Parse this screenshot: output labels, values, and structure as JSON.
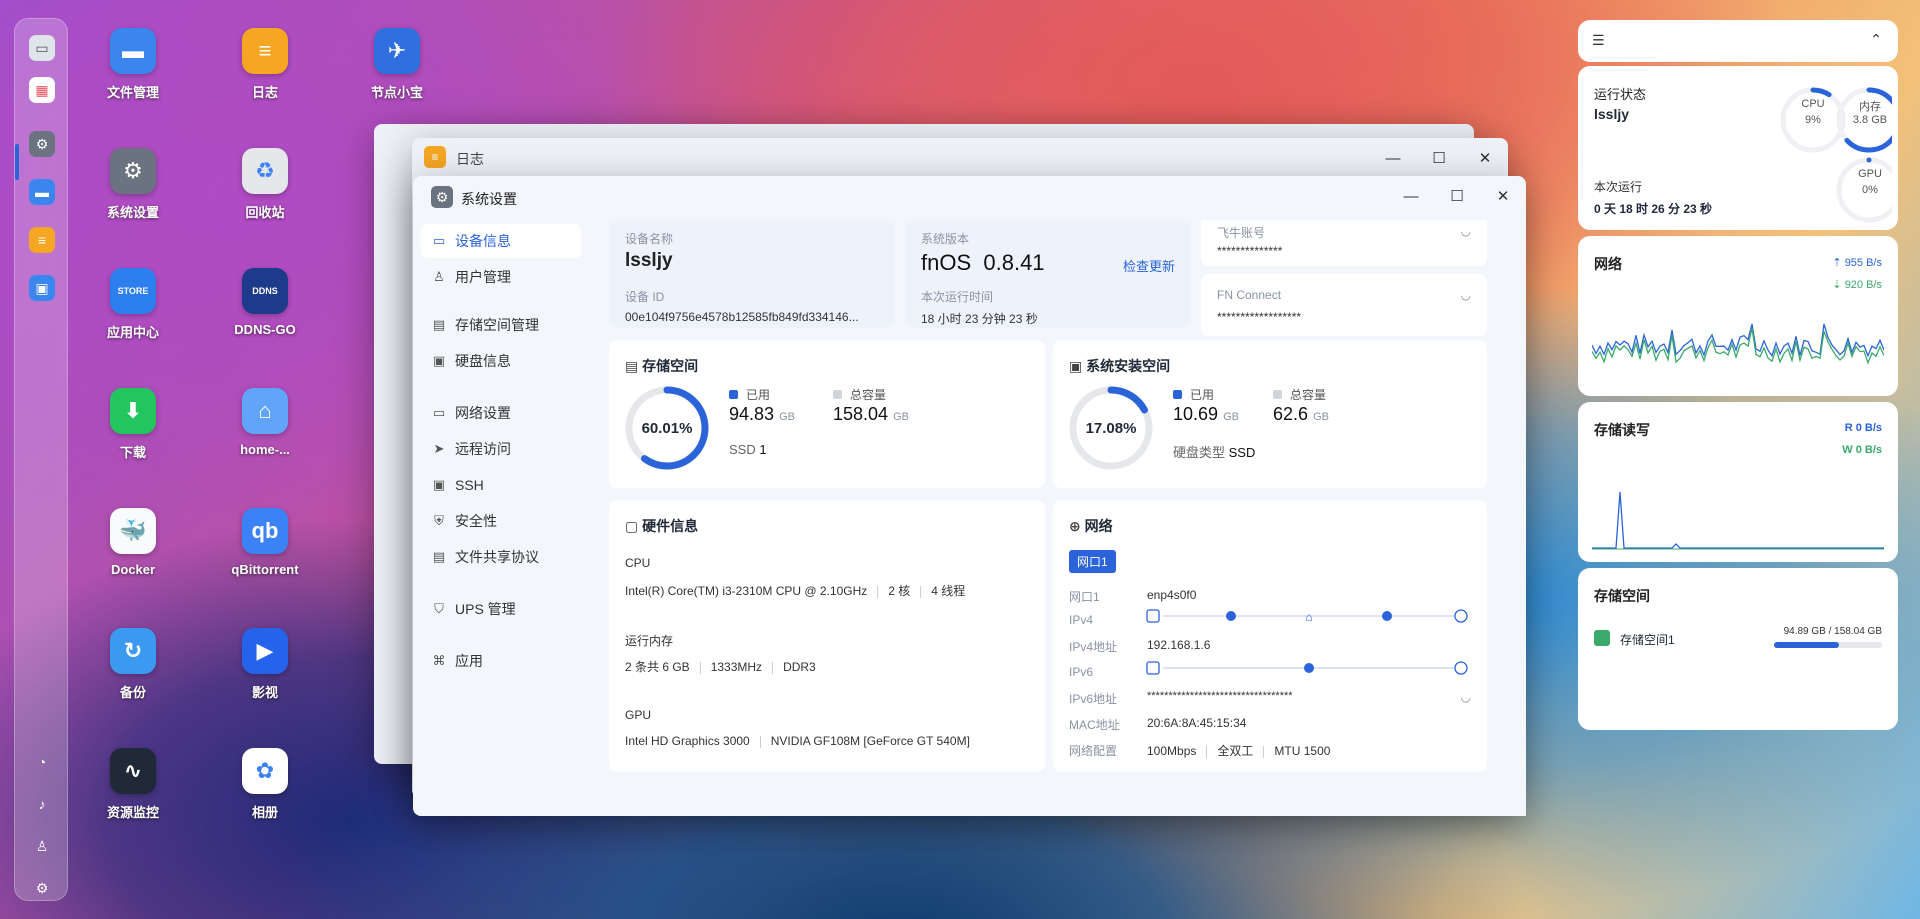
{
  "dock": {
    "icons": [
      "monitor-icon",
      "apps-grid-icon",
      "settings-icon",
      "folder-icon",
      "notes-icon",
      "disk-icon",
      "sync-icon",
      "bell-icon",
      "user-icon",
      "gear-icon"
    ]
  },
  "desktop": [
    {
      "label": "文件管理",
      "color": "#3a86ee",
      "glyph": "▬"
    },
    {
      "label": "日志",
      "color": "#f5a623",
      "glyph": "≡"
    },
    {
      "label": "节点小宝",
      "color": "#2f6fe0",
      "glyph": "✈"
    },
    {
      "label": "系统设置",
      "color": "#6b7280",
      "glyph": "⚙"
    },
    {
      "label": "回收站",
      "color": "#e5e7eb",
      "glyph": "♻"
    },
    {
      "label": "应用中心",
      "color": "#2d7ff0",
      "glyph": "STORE"
    },
    {
      "label": "DDNS-GO",
      "color": "#1e3a8a",
      "glyph": "DDNS"
    },
    {
      "label": "下载",
      "color": "#22c55e",
      "glyph": "⬇"
    },
    {
      "label": "home-...",
      "color": "#60a5fa",
      "glyph": "⌂"
    },
    {
      "label": "Docker",
      "color": "#f8fafc",
      "glyph": "🐳"
    },
    {
      "label": "qBittorrent",
      "color": "#3b82f6",
      "glyph": "qb"
    },
    {
      "label": "备份",
      "color": "#3b9af0",
      "glyph": "↻"
    },
    {
      "label": "影视",
      "color": "#2563eb",
      "glyph": "▶"
    },
    {
      "label": "资源监控",
      "color": "#1f2937",
      "glyph": "∿"
    },
    {
      "label": "相册",
      "color": "#ffffff",
      "glyph": "✿"
    }
  ],
  "bgwin": {
    "title": "日志"
  },
  "settings": {
    "title": "系统设置",
    "nav": [
      {
        "label": "设备信息",
        "icon": "▭"
      },
      {
        "label": "用户管理",
        "icon": "♙"
      },
      {
        "label": "存储空间管理",
        "icon": "▤"
      },
      {
        "label": "硬盘信息",
        "icon": "▣"
      },
      {
        "label": "网络设置",
        "icon": "▭"
      },
      {
        "label": "远程访问",
        "icon": "➤"
      },
      {
        "label": "SSH",
        "icon": "▣"
      },
      {
        "label": "安全性",
        "icon": "⛨"
      },
      {
        "label": "文件共享协议",
        "icon": "▤"
      },
      {
        "label": "UPS 管理",
        "icon": "⛉"
      },
      {
        "label": "应用",
        "icon": "⌘"
      }
    ],
    "device": {
      "name_label": "设备名称",
      "name": "lssljy",
      "id_label": "设备 ID",
      "id": "00e104f9756e4578b12585fb849fd334146..."
    },
    "version": {
      "label": "系统版本",
      "os": "fnOS",
      "ver": "0.8.41",
      "check": "检查更新",
      "uptime_label": "本次运行时间",
      "uptime": "18 小时 23 分钟 23 秒"
    },
    "feiniu": {
      "label": "飞牛账号",
      "value": "**************"
    },
    "fnconnect": {
      "label": "FN Connect",
      "value": "******************"
    },
    "storage": {
      "title": "存储空间",
      "percent": "60.01%",
      "pct": 0.6001,
      "used_label": "已用",
      "used": "94.83",
      "used_unit": "GB",
      "total_label": "总容量",
      "total": "158.04",
      "total_unit": "GB",
      "ssd_label": "SSD",
      "ssd_count": "1"
    },
    "sysspace": {
      "title": "系统安装空间",
      "percent": "17.08%",
      "pct": 0.1708,
      "used_label": "已用",
      "used": "10.69",
      "used_unit": "GB",
      "total_label": "总容量",
      "total": "62.6",
      "total_unit": "GB",
      "disk_label": "硬盘类型",
      "disk_type": "SSD"
    },
    "hardware": {
      "title": "硬件信息",
      "cpu_label": "CPU",
      "cpu": "Intel(R) Core(TM) i3-2310M CPU @ 2.10GHz",
      "cores": "2 核",
      "threads": "4 线程",
      "mem_label": "运行内存",
      "mem": "2 条共 6 GB",
      "mem_freq": "1333MHz",
      "mem_type": "DDR3",
      "gpu_label": "GPU",
      "gpu1": "Intel HD Graphics 3000",
      "gpu2": "NVIDIA GF108M [GeForce GT 540M]"
    },
    "network": {
      "title": "网络",
      "tab": "网口1",
      "port_label": "网口1",
      "port": "enp4s0f0",
      "ipv4_label": "IPv4",
      "ipv4addr_label": "IPv4地址",
      "ipv4addr": "192.168.1.6",
      "ipv6_label": "IPv6",
      "ipv6addr_label": "IPv6地址",
      "ipv6addr": "**********************************",
      "mac_label": "MAC地址",
      "mac": "20:6A:8A:45:15:34",
      "cfg_label": "网络配置",
      "speed": "100Mbps",
      "duplex": "全双工",
      "mtu": "MTU 1500"
    }
  },
  "widgets": {
    "status": {
      "title": "运行状态",
      "host": "lssljy",
      "cpu_label": "CPU",
      "cpu": "9%",
      "cpu_pct": 0.09,
      "mem_label": "内存",
      "mem": "3.8 GB",
      "mem_pct": 0.63,
      "gpu_label": "GPU",
      "gpu": "0%",
      "gpu_pct": 0,
      "uptime_label": "本次运行",
      "uptime": "0 天 18 时 26 分 23 秒"
    },
    "network": {
      "title": "网络",
      "up": "955 B/s",
      "down": "920 B/s"
    },
    "disk": {
      "title": "存储读写",
      "read": "R 0 B/s",
      "write": "W 0 B/s"
    },
    "storage": {
      "title": "存储空间",
      "name": "存储空间1",
      "usage": "94.89 GB / 158.04 GB",
      "pct": 0.6
    }
  },
  "colors": {
    "accent": "#2a64d8",
    "up": "#2a64d8",
    "down": "#3aa96b"
  }
}
